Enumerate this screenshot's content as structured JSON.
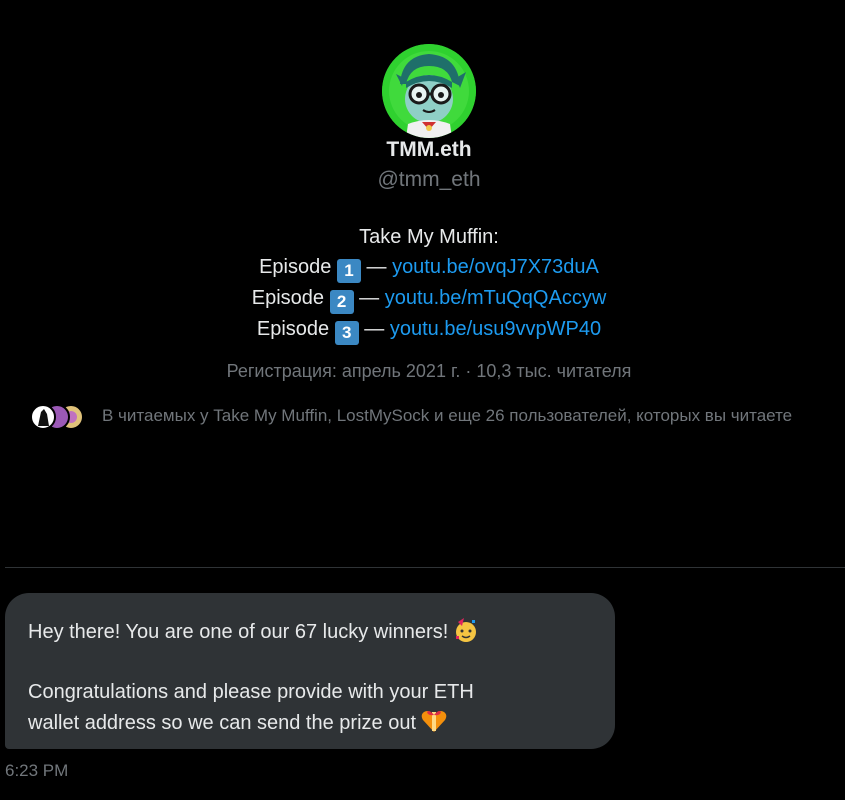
{
  "profile": {
    "display_name": "TMM.eth",
    "handle": "@tmm_eth",
    "bio": {
      "title": "Take My Muffin:",
      "episodes": [
        {
          "label": "Episode",
          "keycap": "1",
          "dash": "—",
          "link": "youtu.be/ovqJ7X73duA"
        },
        {
          "label": "Episode",
          "keycap": "2",
          "dash": "—",
          "link": "youtu.be/mTuQqQAccyw"
        },
        {
          "label": "Episode",
          "keycap": "3",
          "dash": "—",
          "link": "youtu.be/usu9vvpWP40"
        }
      ]
    },
    "registration": "Регистрация: апрель 2021 г.",
    "separator": "·",
    "followers_count": "10,3 тыс. читателя",
    "followed_by": "В читаемых у Take My Muffin, LostMySock и еще 26 пользователей, которых вы читаете"
  },
  "message": {
    "line1": "Hey there! You are one of our 67 lucky winners!",
    "line1_emoji": "party-face-icon",
    "line2": "Congratulations and please provide with your ETH",
    "line3": "wallet address so we can send the prize out",
    "line3_emoji": "gift-heart-icon",
    "time": "6:23 PM"
  },
  "colors": {
    "background": "#000000",
    "link": "#1d9bf0",
    "muted": "#71767b",
    "bubble": "#2f3336",
    "keycap": "#3b88c3",
    "avatar_bg": "#2fd12f"
  }
}
